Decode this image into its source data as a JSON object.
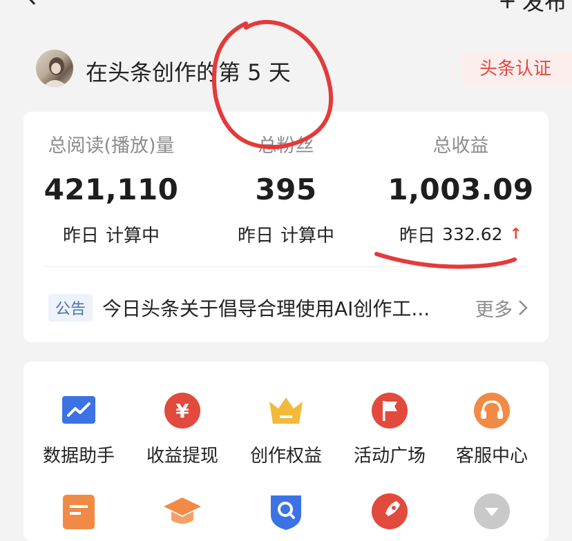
{
  "topbar": {
    "publish_plus": "+",
    "publish_label": "发布"
  },
  "header": {
    "title": "在头条创作的第 5 天",
    "cert_label": "头条认证"
  },
  "stats": [
    {
      "label": "总阅读(播放)量",
      "value": "421,110",
      "sub_prefix": "昨日",
      "sub_value": "计算中"
    },
    {
      "label": "总粉丝",
      "value": "395",
      "sub_prefix": "昨日",
      "sub_value": "计算中"
    },
    {
      "label": "总收益",
      "value": "1,003.09",
      "sub_prefix": "昨日",
      "sub_value": "332.62",
      "trend": "up"
    }
  ],
  "notice": {
    "tag": "公告",
    "text": "今日头条关于倡导合理使用AI创作工...",
    "more": "更多"
  },
  "grid": {
    "row1": [
      {
        "label": "数据助手",
        "icon": "chart-icon",
        "color": "#3b73e6"
      },
      {
        "label": "收益提现",
        "icon": "yuan-icon",
        "color": "#e24a3d"
      },
      {
        "label": "创作权益",
        "icon": "crown-icon",
        "color": "#f3b93a"
      },
      {
        "label": "活动广场",
        "icon": "flag-icon",
        "color": "#e24a3d"
      },
      {
        "label": "客服中心",
        "icon": "headset-icon",
        "color": "#f08a45"
      }
    ],
    "row2_icons": [
      {
        "icon": "document-icon",
        "color": "#f08a45"
      },
      {
        "icon": "graduation-cap-icon",
        "color": "#f08a45"
      },
      {
        "icon": "search-shield-icon",
        "color": "#3b73e6"
      },
      {
        "icon": "rocket-icon",
        "color": "#e24a3d"
      },
      {
        "icon": "more-down-icon",
        "color": "#c9c9c9"
      }
    ]
  },
  "colors": {
    "accent_red": "#e4483f",
    "background": "#f3f3f3",
    "card": "#ffffff"
  }
}
